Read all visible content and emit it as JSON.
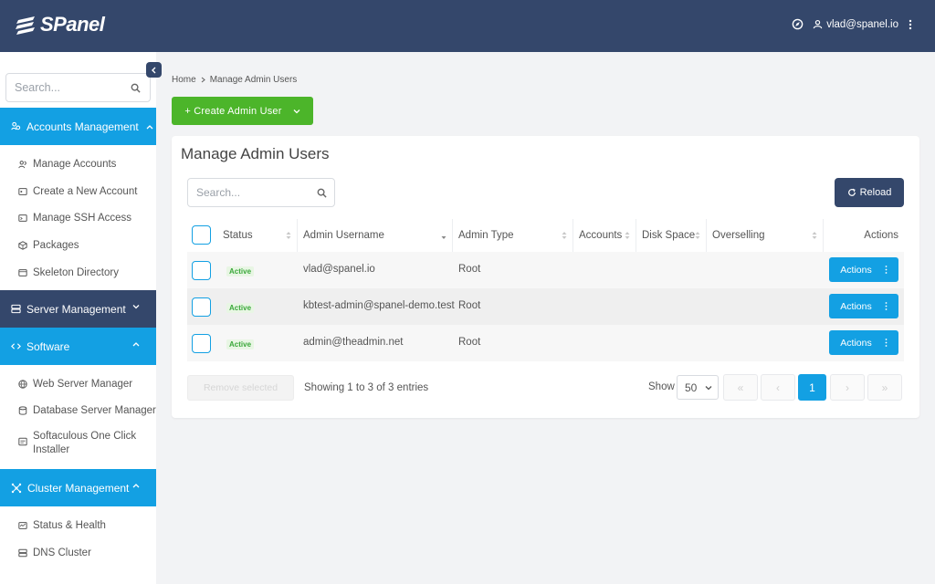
{
  "header": {
    "logo_text": "SPanel",
    "user_email": "vlad@spanel.io"
  },
  "sidebar": {
    "search_placeholder": "Search...",
    "sections": [
      {
        "label": "Accounts Management",
        "items": [
          "Manage Accounts",
          "Create a New Account",
          "Manage SSH Access",
          "Packages",
          "Skeleton Directory"
        ]
      },
      {
        "label": "Server Management",
        "items": []
      },
      {
        "label": "Software",
        "items": [
          "Web Server Manager",
          "Database Server Manager",
          "Softaculous One Click Installer"
        ]
      },
      {
        "label": "Cluster Management",
        "items": [
          "Status & Health",
          "DNS Cluster"
        ]
      }
    ]
  },
  "breadcrumb": {
    "home": "Home",
    "current": "Manage Admin Users"
  },
  "create_button": "+ Create Admin User",
  "card": {
    "title": "Manage Admin Users",
    "search_placeholder": "Search...",
    "reload_label": "Reload"
  },
  "table": {
    "columns": [
      "Status",
      "Admin Username",
      "Admin Type",
      "Accounts",
      "Disk Space",
      "Overselling",
      "Actions"
    ],
    "rows": [
      {
        "status": "Active",
        "username": "vlad@spanel.io",
        "type": "Root",
        "action": "Actions"
      },
      {
        "status": "Active",
        "username": "kbtest-admin@spanel-demo.test",
        "type": "Root",
        "action": "Actions"
      },
      {
        "status": "Active",
        "username": "admin@theadmin.net",
        "type": "Root",
        "action": "Actions"
      }
    ]
  },
  "footer": {
    "remove_label": "Remove selected",
    "showing": "Showing 1 to 3 of 3 entries",
    "show_label": "Show",
    "page_size": "50",
    "current_page": "1",
    "pager": {
      "first": "«",
      "prev": "‹",
      "next": "›",
      "last": "»"
    }
  },
  "colors": {
    "header_bg": "#34476b",
    "accent_blue": "#13a0e3",
    "create_green": "#4cb52a",
    "active_green": "#3aa83a"
  }
}
